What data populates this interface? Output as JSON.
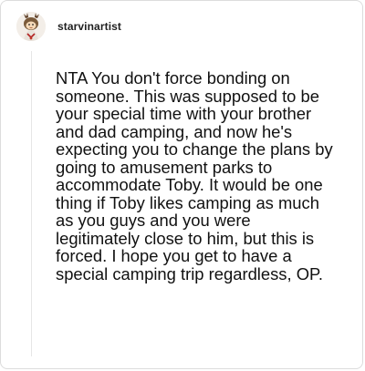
{
  "comment": {
    "username": "starvinartist",
    "avatar_icon": "cartoon-character-avatar-icon",
    "body": "NTA You don't force bonding on someone. This was supposed to be your special time with your brother and dad camping, and now he's expecting you to change the plans by going to amusement parks to accommodate Toby. It would be one thing if Toby likes camping as much as you guys and you were legitimately close to him, but this is forced. I hope you get to have a special camping trip regardless, OP."
  },
  "colors": {
    "border": "#dcdcdc",
    "text": "#111111",
    "username": "#1f1f1f"
  }
}
